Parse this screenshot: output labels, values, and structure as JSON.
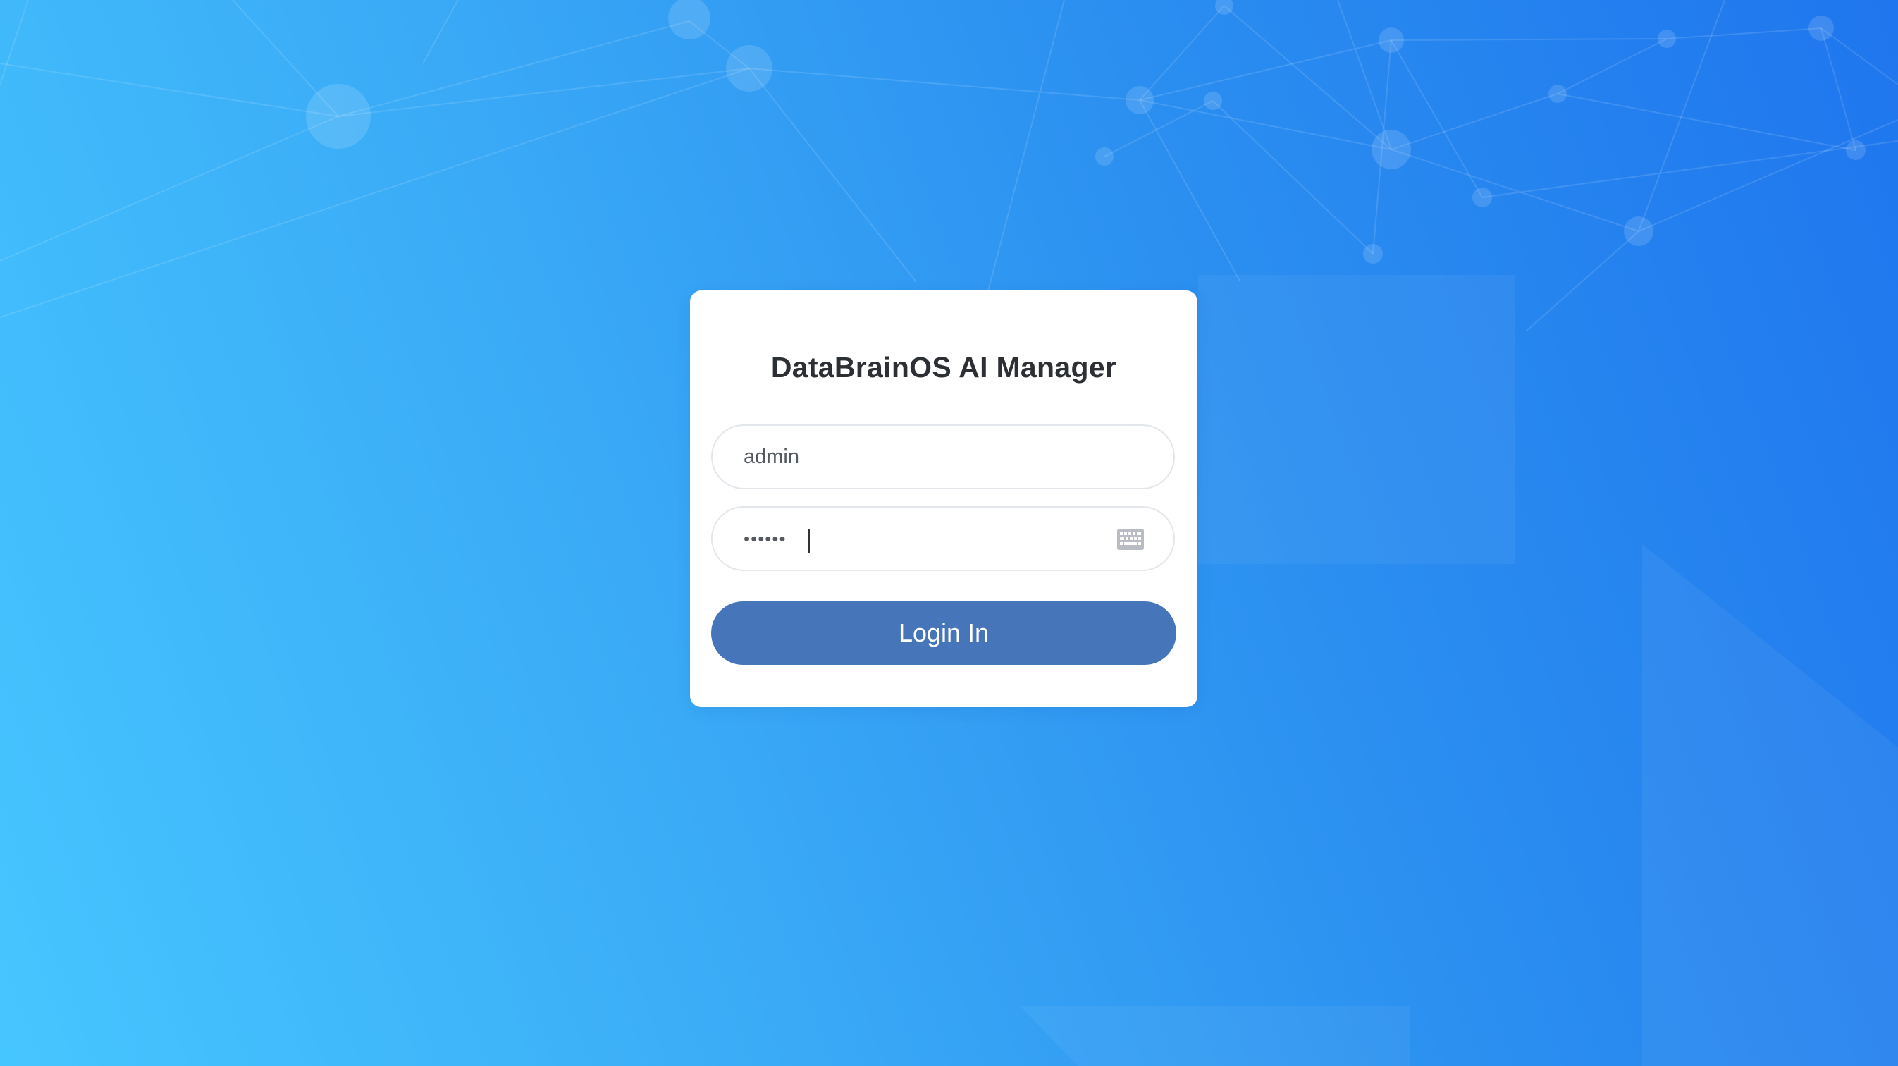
{
  "app": {
    "title": "DataBrainOS AI Manager"
  },
  "login_form": {
    "username_value": "admin",
    "password_value": "••••••",
    "keyboard_icon": "keyboard-icon",
    "login_button_label": "Login In"
  },
  "colors": {
    "background_start": "#46c6ff",
    "background_end": "#1f76ee",
    "button": "#4676b9",
    "title_text": "#2c2f33"
  }
}
